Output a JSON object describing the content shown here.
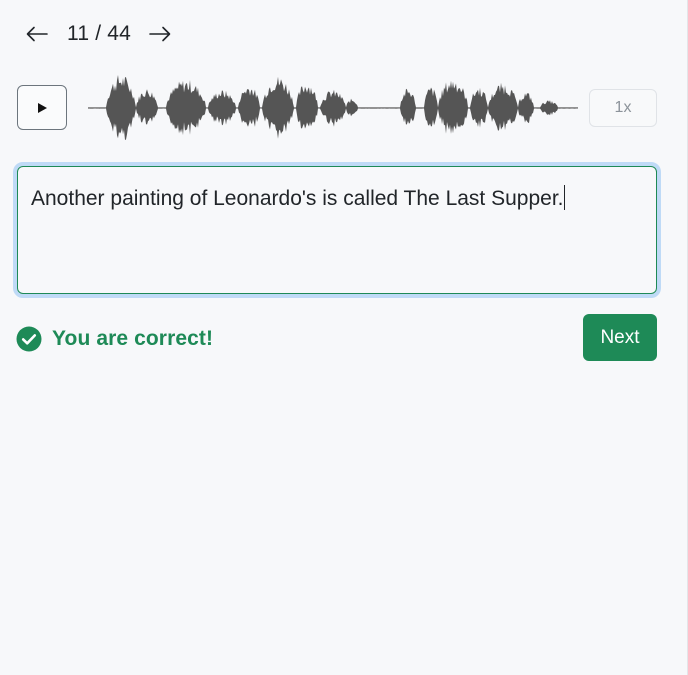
{
  "navigation": {
    "prev_icon": "arrow-left-icon",
    "next_icon": "arrow-right-icon",
    "counter": "11 / 44"
  },
  "player": {
    "play_icon": "play-icon",
    "speed_label": "1x"
  },
  "answer": {
    "value": "Another painting of Leonardo's is called The Last Supper."
  },
  "feedback": {
    "icon": "check-circle-icon",
    "message": "You are correct!"
  },
  "actions": {
    "next_label": "Next"
  },
  "colors": {
    "success": "#1e8a57",
    "focus_ring": "#bfdaf6",
    "waveform": "#555555",
    "background": "#f7f8fa"
  }
}
